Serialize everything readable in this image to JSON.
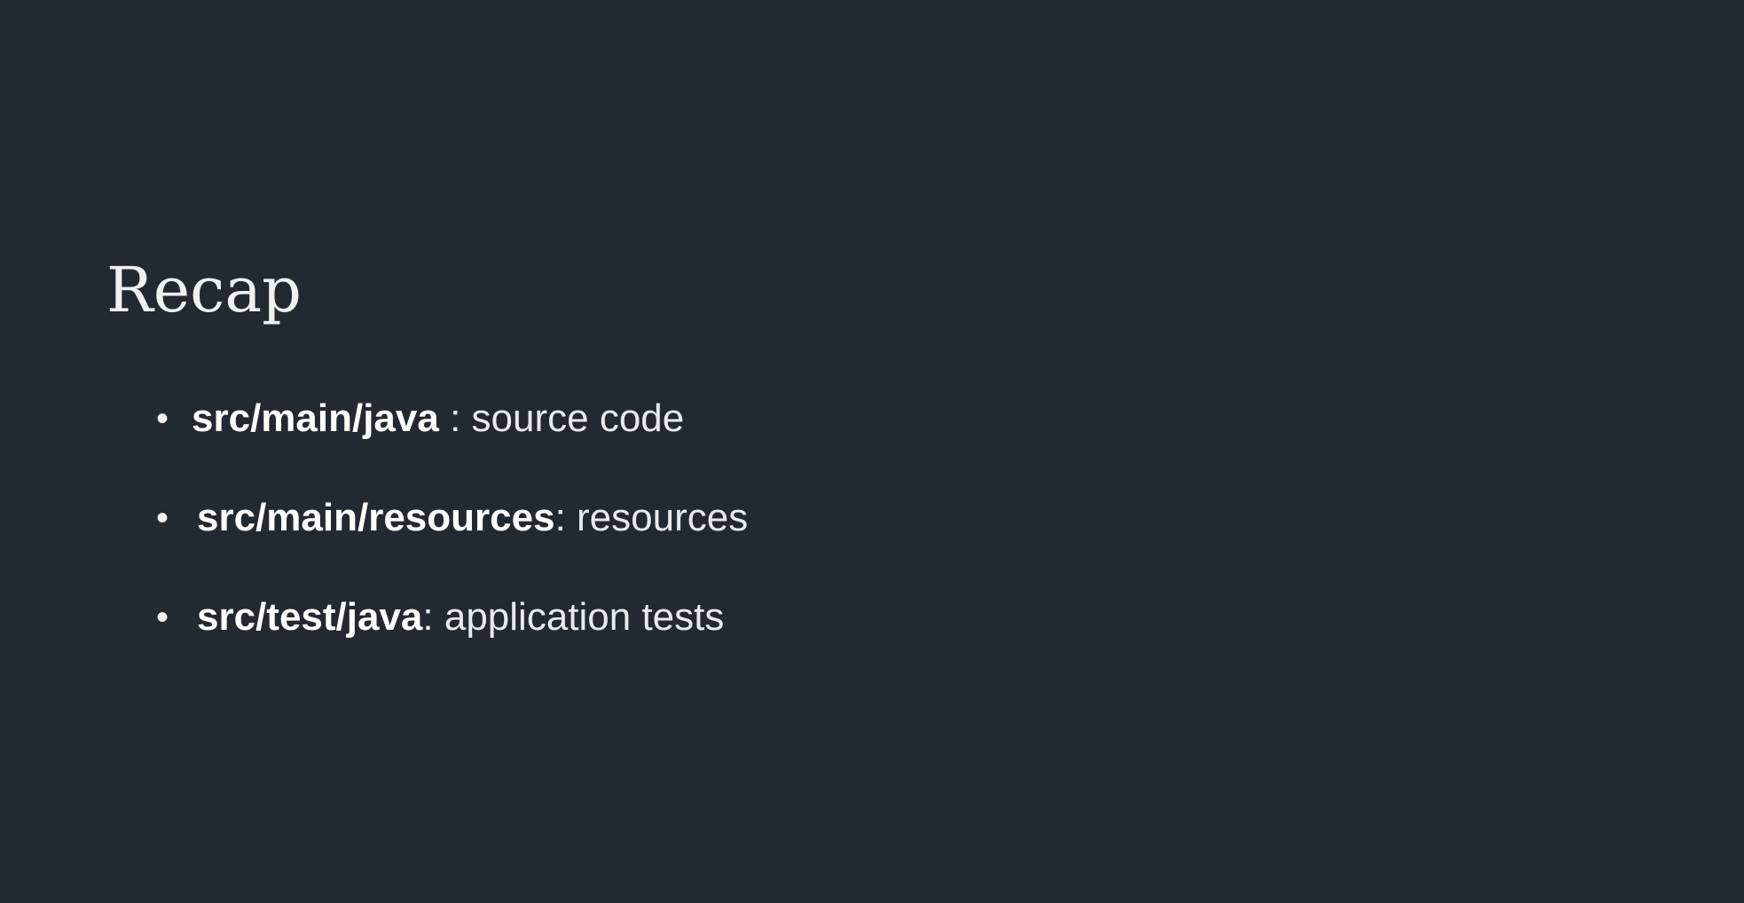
{
  "slide": {
    "title": "Recap",
    "items": [
      {
        "path": "src/main/java",
        "separator": " : ",
        "description": "source code"
      },
      {
        "path": "src/main/resources",
        "separator": ": ",
        "description": "resources"
      },
      {
        "path": "src/test/java",
        "separator": ": ",
        "description": "application tests"
      }
    ],
    "colors": {
      "background": "#232931",
      "text": "#f2f3f5"
    }
  }
}
